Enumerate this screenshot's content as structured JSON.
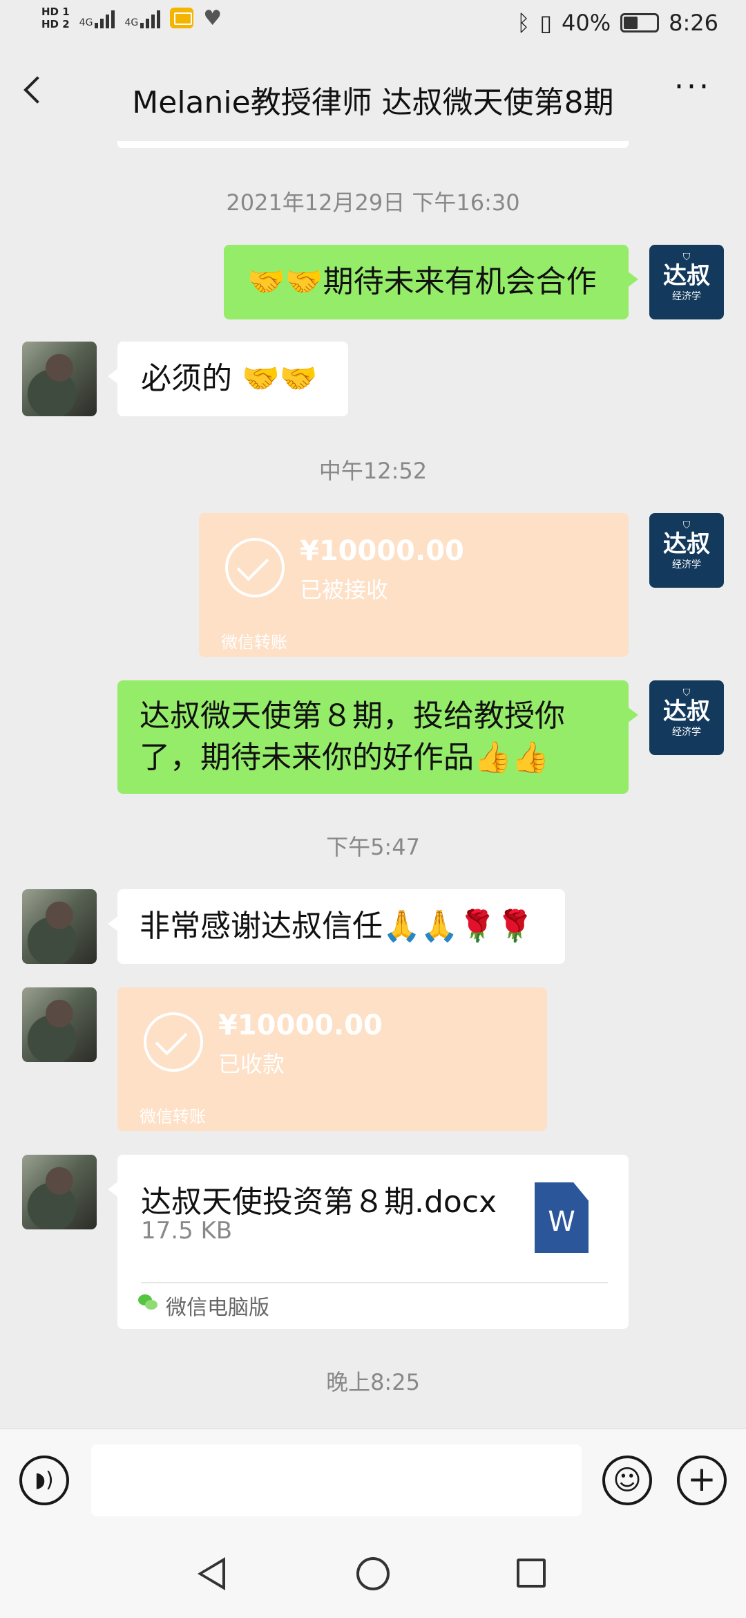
{
  "status": {
    "hd1": "HD 1",
    "hd2": "HD 2",
    "net1": "4G",
    "net2": "4G",
    "battery": "40%",
    "clock": "8:26"
  },
  "header": {
    "title": "Melanie教授律师 达叔微天使第8期",
    "more": "···"
  },
  "avatar_me": {
    "main": "达叔",
    "sub": "经济学"
  },
  "messages": {
    "time1": "2021年12月29日 下午16:30",
    "m1": "🤝🤝期待未来有机会合作",
    "m2": "必须的 🤝🤝",
    "time2": "中午12:52",
    "transfer1": {
      "amount": "¥10000.00",
      "status": "已被接收",
      "footer": "微信转账"
    },
    "m3": "达叔微天使第８期，投给教授你了，期待未来你的好作品👍👍",
    "time3": "下午5:47",
    "m4": "非常感谢达叔信任🙏🙏🌹🌹",
    "transfer2": {
      "amount": "¥10000.00",
      "status": "已收款",
      "footer": "微信转账"
    },
    "file": {
      "name": "达叔天使投资第８期.docx",
      "size": "17.5 KB",
      "source": "微信电脑版",
      "icon_letter": "W"
    },
    "time4": "晚上8:25"
  },
  "inputbar": {
    "placeholder": ""
  },
  "icons": {
    "back": "back-arrow-icon",
    "voice": "voice-icon",
    "emoji": "emoji-icon",
    "plus": "plus-icon"
  },
  "colors": {
    "bubble_self": "#95ec69",
    "transfer_bg": "#fde0c6",
    "background": "#ededed"
  }
}
